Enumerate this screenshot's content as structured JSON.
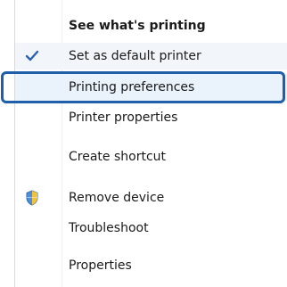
{
  "context_menu": {
    "items": [
      {
        "label": "See what's printing",
        "bold": true,
        "icon": null,
        "checked": false
      },
      {
        "label": "Set as default printer",
        "bold": false,
        "icon": "checkmark-icon",
        "checked": true
      },
      {
        "label": "Printing preferences",
        "bold": false,
        "icon": null,
        "checked": false,
        "highlighted": true
      },
      {
        "label": "Printer properties",
        "bold": false,
        "icon": null,
        "checked": false
      },
      {
        "label": "Create shortcut",
        "bold": false,
        "icon": null,
        "checked": false
      },
      {
        "label": "Remove device",
        "bold": false,
        "icon": "shield-icon",
        "checked": false
      },
      {
        "label": "Troubleshoot",
        "bold": false,
        "icon": null,
        "checked": false
      },
      {
        "label": "Properties",
        "bold": false,
        "icon": null,
        "checked": false
      }
    ]
  },
  "colors": {
    "highlight_border": "#1f5ea8",
    "checkmark": "#2a62b3"
  }
}
